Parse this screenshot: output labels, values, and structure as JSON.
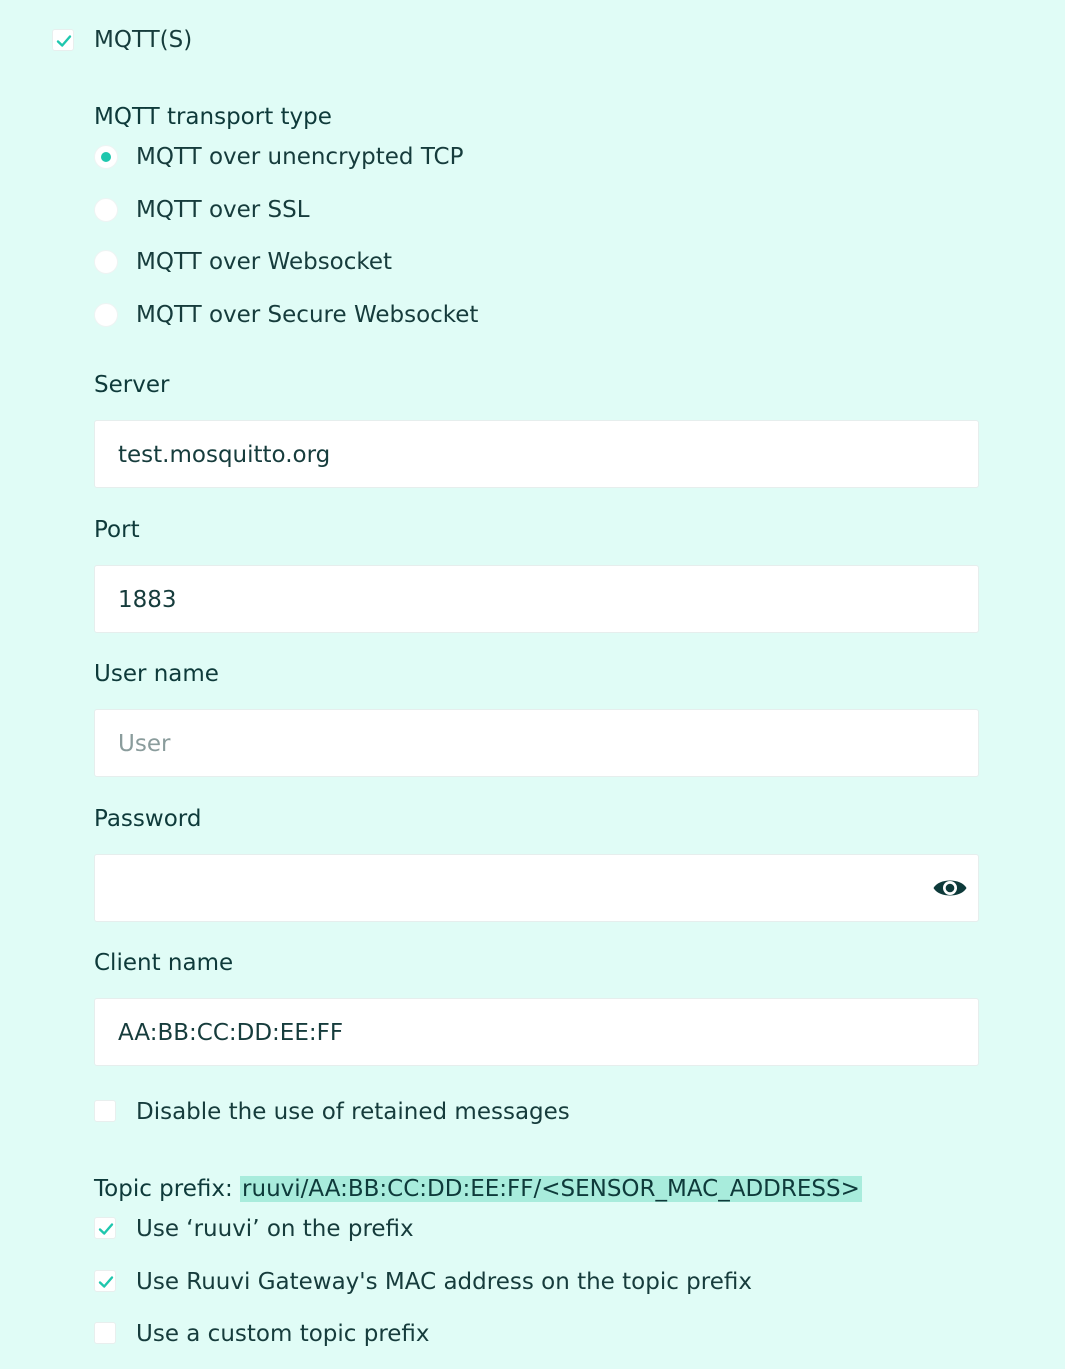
{
  "mqtt_enable": {
    "label": "MQTT(S)",
    "checked": true
  },
  "transport": {
    "heading": "MQTT transport type",
    "options": [
      {
        "label": "MQTT over unencrypted TCP",
        "selected": true
      },
      {
        "label": "MQTT over SSL",
        "selected": false
      },
      {
        "label": "MQTT over Websocket",
        "selected": false
      },
      {
        "label": "MQTT over Secure Websocket",
        "selected": false
      }
    ]
  },
  "server": {
    "label": "Server",
    "value": "test.mosquitto.org"
  },
  "port": {
    "label": "Port",
    "value": "1883"
  },
  "username": {
    "label": "User name",
    "value": "",
    "placeholder": "User"
  },
  "password": {
    "label": "Password",
    "value": "",
    "toggle_icon": "eye-icon"
  },
  "client_name": {
    "label": "Client name",
    "value": "AA:BB:CC:DD:EE:FF"
  },
  "retained": {
    "label": "Disable the use of retained messages",
    "checked": false
  },
  "topic_prefix": {
    "label": "Topic prefix: ",
    "value": "ruuvi/AA:BB:CC:DD:EE:FF/<SENSOR_MAC_ADDRESS>",
    "options": [
      {
        "label": "Use ‘ruuvi’ on the prefix",
        "checked": true
      },
      {
        "label": "Use Ruuvi Gateway's MAC address on the topic prefix",
        "checked": true
      },
      {
        "label": "Use a custom topic prefix",
        "checked": false
      }
    ]
  },
  "colors": {
    "background": "#e0fcf6",
    "accent": "#1fc7ae",
    "text": "#0e3a3a",
    "highlight": "#a8ecdc"
  }
}
